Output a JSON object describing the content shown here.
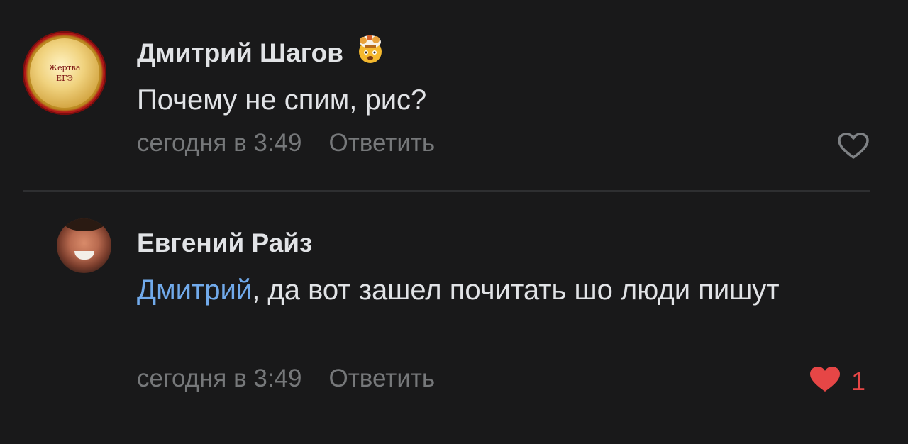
{
  "comments": [
    {
      "author": "Дмитрий Шагов",
      "author_emoji": "exploding-head-emoji",
      "avatar_badge_text": [
        "Жертва",
        "ЕГЭ"
      ],
      "text": "Почему не спим, рис?",
      "time": "сегодня в 3:49",
      "reply_label": "Ответить",
      "liked": false,
      "like_count": ""
    },
    {
      "author": "Евгений Райз",
      "mention": "Дмитрий",
      "text": ", да вот зашел почитать шо люди пишут",
      "time": "сегодня в 3:49",
      "reply_label": "Ответить",
      "liked": true,
      "like_count": "1"
    }
  ],
  "colors": {
    "background": "#19191a",
    "text": "#e1e3e6",
    "secondary": "#76787a",
    "mention": "#71aaeb",
    "like_active": "#e64646"
  }
}
